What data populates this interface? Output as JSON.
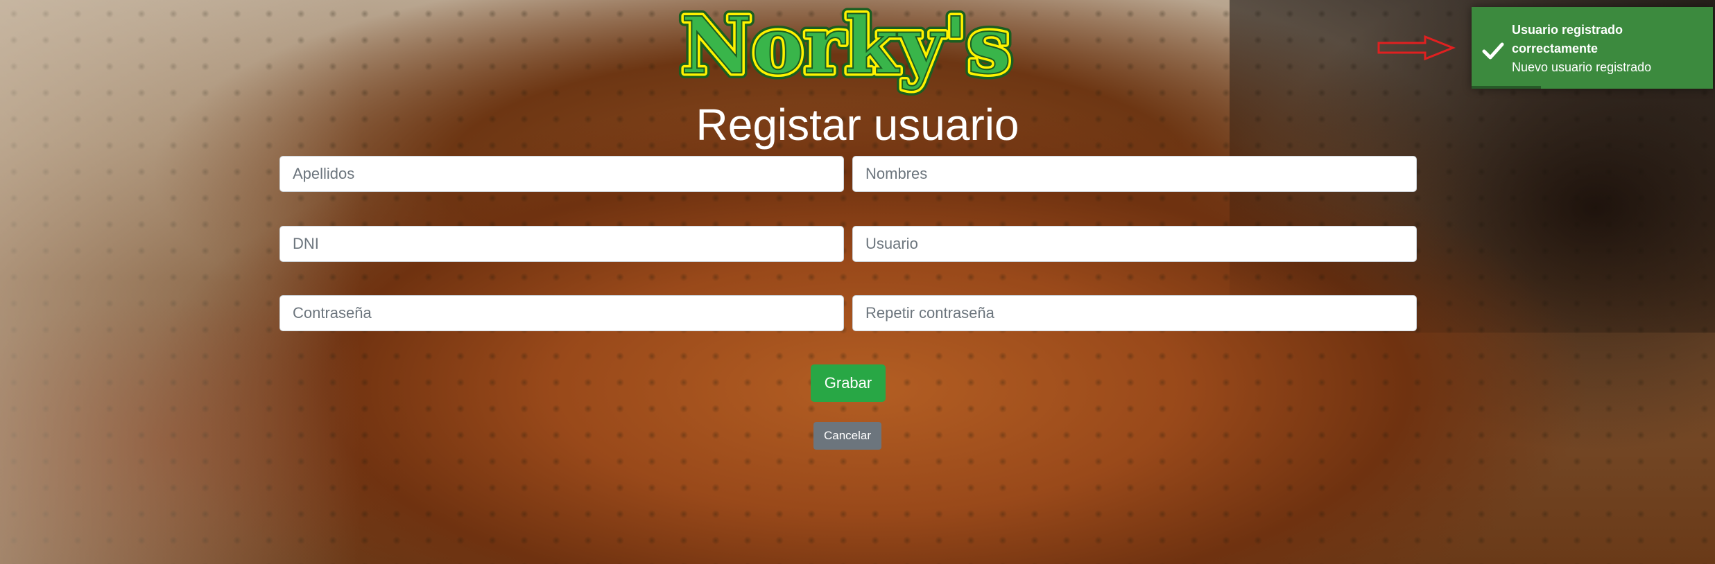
{
  "brand": {
    "logo_text": "Norky's",
    "logo_fill": "#39b54a",
    "logo_inner": "#fff200",
    "logo_outline": "#1a5e20"
  },
  "page": {
    "title": "Registar usuario"
  },
  "form": {
    "apellidos_placeholder": "Apellidos",
    "nombres_placeholder": "Nombres",
    "dni_placeholder": "DNI",
    "usuario_placeholder": "Usuario",
    "password_placeholder": "Contraseña",
    "repeat_password_placeholder": "Repetir contraseña",
    "save_label": "Grabar",
    "cancel_label": "Cancelar"
  },
  "toast": {
    "title": "Usuario registrado correctamente",
    "message": "Nuevo usuario registrado",
    "icon": "check-icon",
    "color": "#3c8a3e"
  },
  "annotation": {
    "icon": "red-arrow-icon",
    "color": "#e02020"
  }
}
